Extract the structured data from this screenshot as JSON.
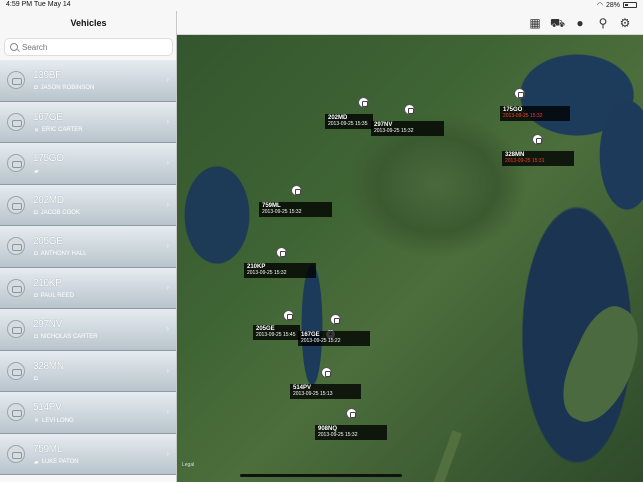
{
  "status_bar": {
    "time": "4:59 PM",
    "date": "Tue May 14",
    "battery": "28%"
  },
  "sidebar": {
    "title": "Vehicles",
    "search_placeholder": "Search",
    "vehicles": [
      {
        "reg": "139BF",
        "driver": "JASON ROBINSON",
        "icon": "bus-icon"
      },
      {
        "reg": "167GE",
        "driver": "ERIC CARTER",
        "icon": "tools-icon"
      },
      {
        "reg": "175GO",
        "driver": "",
        "icon": "truck-icon"
      },
      {
        "reg": "202MD",
        "driver": "JACOB COOK",
        "icon": "bus-icon"
      },
      {
        "reg": "205GE",
        "driver": "ANTHONY HALL",
        "icon": "bus-icon"
      },
      {
        "reg": "210KP",
        "driver": "PAUL REED",
        "icon": "bus-icon"
      },
      {
        "reg": "297NV",
        "driver": "NICHOLAS CARTER",
        "icon": "bus-icon"
      },
      {
        "reg": "328MN",
        "driver": "",
        "icon": "bus-icon"
      },
      {
        "reg": "514PV",
        "driver": "LEVI LONG",
        "icon": "tools-icon"
      },
      {
        "reg": "759ML",
        "driver": "LUKE PATON",
        "icon": "truck-icon"
      }
    ]
  },
  "toolbar": {
    "icons": [
      "grid-icon",
      "truck-icon",
      "person-icon",
      "pin-person-icon",
      "gear-icon"
    ]
  },
  "map": {
    "legal": "Legal",
    "labels": [
      {
        "reg": "202MD",
        "ts": "2013-09-25 15:35",
        "red": false
      },
      {
        "reg": "297NV",
        "ts": "2013-09-25 15:32",
        "red": false
      },
      {
        "reg": "175GO",
        "ts": "2013-09-25 15:32",
        "red": true
      },
      {
        "reg": "328MN",
        "ts": "2013-09-25 15:31",
        "red": true
      },
      {
        "reg": "759ML",
        "ts": "2013-09-25 15:32",
        "red": false
      },
      {
        "reg": "210KP",
        "ts": "2013-09-25 15:32",
        "red": false
      },
      {
        "reg": "205GE",
        "ts": "2013-09-25 15:45",
        "red": false
      },
      {
        "reg": "167GE",
        "ts": "2013-09-25 15:22",
        "red": false
      },
      {
        "reg": "514PV",
        "ts": "2013-09-25 15:13",
        "red": false
      },
      {
        "reg": "908NQ",
        "ts": "2013-09-25 15:32",
        "red": false
      }
    ],
    "cluster_count": "2"
  }
}
